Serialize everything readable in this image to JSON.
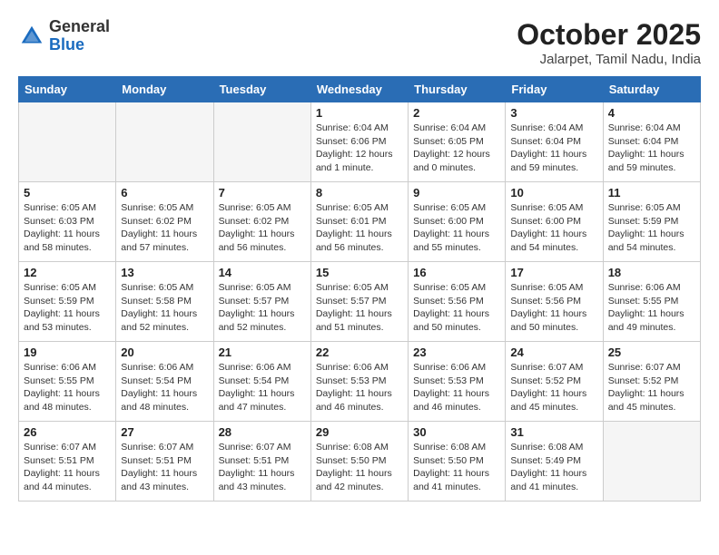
{
  "header": {
    "logo_line1": "General",
    "logo_line2": "Blue",
    "month": "October 2025",
    "location": "Jalarpet, Tamil Nadu, India"
  },
  "days_of_week": [
    "Sunday",
    "Monday",
    "Tuesday",
    "Wednesday",
    "Thursday",
    "Friday",
    "Saturday"
  ],
  "weeks": [
    [
      {
        "day": "",
        "info": ""
      },
      {
        "day": "",
        "info": ""
      },
      {
        "day": "",
        "info": ""
      },
      {
        "day": "1",
        "info": "Sunrise: 6:04 AM\nSunset: 6:06 PM\nDaylight: 12 hours\nand 1 minute."
      },
      {
        "day": "2",
        "info": "Sunrise: 6:04 AM\nSunset: 6:05 PM\nDaylight: 12 hours\nand 0 minutes."
      },
      {
        "day": "3",
        "info": "Sunrise: 6:04 AM\nSunset: 6:04 PM\nDaylight: 11 hours\nand 59 minutes."
      },
      {
        "day": "4",
        "info": "Sunrise: 6:04 AM\nSunset: 6:04 PM\nDaylight: 11 hours\nand 59 minutes."
      }
    ],
    [
      {
        "day": "5",
        "info": "Sunrise: 6:05 AM\nSunset: 6:03 PM\nDaylight: 11 hours\nand 58 minutes."
      },
      {
        "day": "6",
        "info": "Sunrise: 6:05 AM\nSunset: 6:02 PM\nDaylight: 11 hours\nand 57 minutes."
      },
      {
        "day": "7",
        "info": "Sunrise: 6:05 AM\nSunset: 6:02 PM\nDaylight: 11 hours\nand 56 minutes."
      },
      {
        "day": "8",
        "info": "Sunrise: 6:05 AM\nSunset: 6:01 PM\nDaylight: 11 hours\nand 56 minutes."
      },
      {
        "day": "9",
        "info": "Sunrise: 6:05 AM\nSunset: 6:00 PM\nDaylight: 11 hours\nand 55 minutes."
      },
      {
        "day": "10",
        "info": "Sunrise: 6:05 AM\nSunset: 6:00 PM\nDaylight: 11 hours\nand 54 minutes."
      },
      {
        "day": "11",
        "info": "Sunrise: 6:05 AM\nSunset: 5:59 PM\nDaylight: 11 hours\nand 54 minutes."
      }
    ],
    [
      {
        "day": "12",
        "info": "Sunrise: 6:05 AM\nSunset: 5:59 PM\nDaylight: 11 hours\nand 53 minutes."
      },
      {
        "day": "13",
        "info": "Sunrise: 6:05 AM\nSunset: 5:58 PM\nDaylight: 11 hours\nand 52 minutes."
      },
      {
        "day": "14",
        "info": "Sunrise: 6:05 AM\nSunset: 5:57 PM\nDaylight: 11 hours\nand 52 minutes."
      },
      {
        "day": "15",
        "info": "Sunrise: 6:05 AM\nSunset: 5:57 PM\nDaylight: 11 hours\nand 51 minutes."
      },
      {
        "day": "16",
        "info": "Sunrise: 6:05 AM\nSunset: 5:56 PM\nDaylight: 11 hours\nand 50 minutes."
      },
      {
        "day": "17",
        "info": "Sunrise: 6:05 AM\nSunset: 5:56 PM\nDaylight: 11 hours\nand 50 minutes."
      },
      {
        "day": "18",
        "info": "Sunrise: 6:06 AM\nSunset: 5:55 PM\nDaylight: 11 hours\nand 49 minutes."
      }
    ],
    [
      {
        "day": "19",
        "info": "Sunrise: 6:06 AM\nSunset: 5:55 PM\nDaylight: 11 hours\nand 48 minutes."
      },
      {
        "day": "20",
        "info": "Sunrise: 6:06 AM\nSunset: 5:54 PM\nDaylight: 11 hours\nand 48 minutes."
      },
      {
        "day": "21",
        "info": "Sunrise: 6:06 AM\nSunset: 5:54 PM\nDaylight: 11 hours\nand 47 minutes."
      },
      {
        "day": "22",
        "info": "Sunrise: 6:06 AM\nSunset: 5:53 PM\nDaylight: 11 hours\nand 46 minutes."
      },
      {
        "day": "23",
        "info": "Sunrise: 6:06 AM\nSunset: 5:53 PM\nDaylight: 11 hours\nand 46 minutes."
      },
      {
        "day": "24",
        "info": "Sunrise: 6:07 AM\nSunset: 5:52 PM\nDaylight: 11 hours\nand 45 minutes."
      },
      {
        "day": "25",
        "info": "Sunrise: 6:07 AM\nSunset: 5:52 PM\nDaylight: 11 hours\nand 45 minutes."
      }
    ],
    [
      {
        "day": "26",
        "info": "Sunrise: 6:07 AM\nSunset: 5:51 PM\nDaylight: 11 hours\nand 44 minutes."
      },
      {
        "day": "27",
        "info": "Sunrise: 6:07 AM\nSunset: 5:51 PM\nDaylight: 11 hours\nand 43 minutes."
      },
      {
        "day": "28",
        "info": "Sunrise: 6:07 AM\nSunset: 5:51 PM\nDaylight: 11 hours\nand 43 minutes."
      },
      {
        "day": "29",
        "info": "Sunrise: 6:08 AM\nSunset: 5:50 PM\nDaylight: 11 hours\nand 42 minutes."
      },
      {
        "day": "30",
        "info": "Sunrise: 6:08 AM\nSunset: 5:50 PM\nDaylight: 11 hours\nand 41 minutes."
      },
      {
        "day": "31",
        "info": "Sunrise: 6:08 AM\nSunset: 5:49 PM\nDaylight: 11 hours\nand 41 minutes."
      },
      {
        "day": "",
        "info": ""
      }
    ]
  ]
}
